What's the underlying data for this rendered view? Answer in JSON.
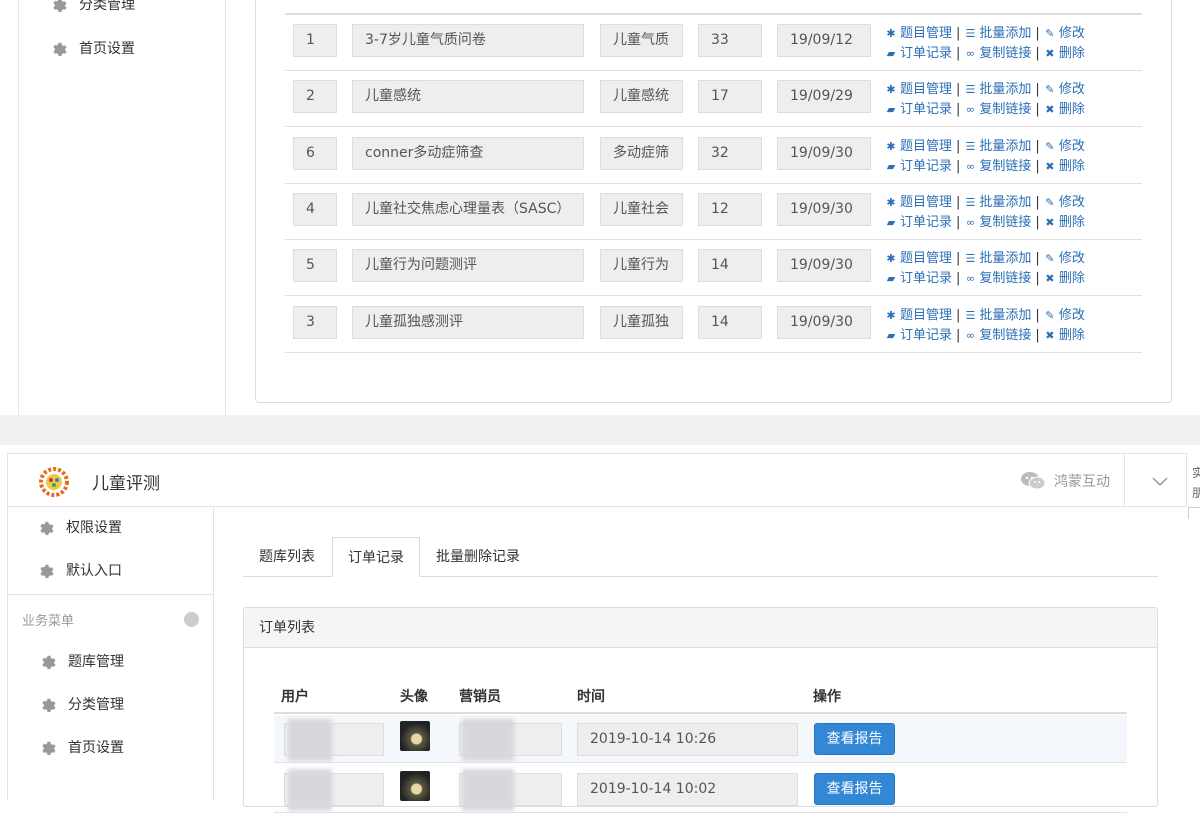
{
  "top_sidebar": {
    "items": [
      {
        "label": "分类管理"
      },
      {
        "label": "首页设置"
      }
    ]
  },
  "question_rows": [
    {
      "id": "1",
      "name": "3-7岁儿童气质问卷",
      "category": "儿童气质",
      "count": "33",
      "date": "19/09/12"
    },
    {
      "id": "2",
      "name": "儿童感统",
      "category": "儿童感统",
      "count": "17",
      "date": "19/09/29"
    },
    {
      "id": "6",
      "name": "conner多动症筛查",
      "category": "多动症筛",
      "count": "32",
      "date": "19/09/30"
    },
    {
      "id": "4",
      "name": "儿童社交焦虑心理量表（SASC）",
      "category": "儿童社会",
      "count": "12",
      "date": "19/09/30"
    },
    {
      "id": "5",
      "name": "儿童行为问题测评",
      "category": "儿童行为",
      "count": "14",
      "date": "19/09/30"
    },
    {
      "id": "3",
      "name": "儿童孤独感测评",
      "category": "儿童孤独",
      "count": "14",
      "date": "19/09/30"
    }
  ],
  "row_actions": {
    "manage": "题目管理",
    "batch_add": "批量添加",
    "edit": "修改",
    "orders": "订单记录",
    "copy_link": "复制链接",
    "delete": "删除"
  },
  "header": {
    "title": "儿童评测",
    "wechat_label": "鸿蒙互动",
    "edge_text": "实\n朋"
  },
  "sidebar": {
    "top_items": [
      {
        "label": "权限设置"
      },
      {
        "label": "默认入口"
      }
    ],
    "group_title": "业务菜单",
    "group_items": [
      {
        "label": "题库管理"
      },
      {
        "label": "分类管理"
      },
      {
        "label": "首页设置"
      }
    ]
  },
  "tabs": [
    {
      "label": "题库列表",
      "active": false
    },
    {
      "label": "订单记录",
      "active": true
    },
    {
      "label": "批量删除记录",
      "active": false
    }
  ],
  "order_panel": {
    "title": "订单列表",
    "columns": [
      "用户",
      "头像",
      "营销员",
      "时间",
      "操作"
    ],
    "rows": [
      {
        "time": "2019-10-14 10:26",
        "action": "查看报告"
      },
      {
        "time": "2019-10-14 10:02",
        "action": "查看报告"
      }
    ]
  },
  "colors": {
    "link": "#2a6fb7",
    "primary_button": "#3388d6",
    "border": "#dddddd",
    "cell_bg": "#eeeeee"
  },
  "icons": [
    "gear-icon",
    "wechat-icon",
    "chevron-down-icon",
    "cog-icon",
    "list-icon",
    "edit-icon",
    "book-icon",
    "link-icon",
    "close-icon"
  ]
}
